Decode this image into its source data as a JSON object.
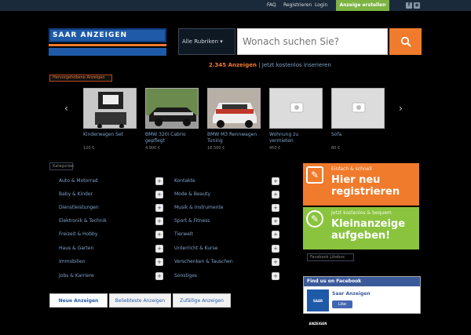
{
  "topbar": {
    "faq": "FAQ",
    "register": "Registrieren",
    "login": "Login",
    "create_ad": "Anzeige erstellen",
    "social_icons": [
      "facebook-icon",
      "rss-icon"
    ]
  },
  "logo": {
    "text": "SAAR ANZEIGEN"
  },
  "search": {
    "category": "Alle Rubriken",
    "placeholder": "Wonach suchen Sie?"
  },
  "subline": {
    "count": "2.345 Anzeigen",
    "rest": " | Jetzt kostenlos inserieren"
  },
  "featured": {
    "label": "Hervorgehobene Anzeigen",
    "items": [
      {
        "title": "Kinderwagen Set",
        "price": "120 €"
      },
      {
        "title": "BMW 320i Cabrio gepflegt",
        "price": "4.900 €"
      },
      {
        "title": "BMW M3 Rennwagen Tuning",
        "price": "18.500 €"
      },
      {
        "title": "Wohnung zu vermieten",
        "price": "450 €"
      },
      {
        "title": "Sofa",
        "price": "80 €"
      }
    ]
  },
  "categories": {
    "label": "Kategorien",
    "col1": [
      "Auto & Motorrad",
      "Baby & Kinder",
      "Dienstleistungen",
      "Elektronik & Technik",
      "Freizeit & Hobby",
      "Haus & Garten",
      "Immobilien",
      "Jobs & Karriere"
    ],
    "col2": [
      "Kontakte",
      "Mode & Beauty",
      "Musik & Instrumente",
      "Sport & Fitness",
      "Tierwelt",
      "Unterricht & Kurse",
      "Verschenken & Tauschen",
      "Sonstiges"
    ]
  },
  "tabs": [
    "Neue Anzeigen",
    "Beliebteste Anzeigen",
    "Zufällige Anzeigen"
  ],
  "promo1": {
    "small": "Einfach & schnell",
    "big": "Hier neu registrieren"
  },
  "promo2": {
    "small": "Jetzt kostenlos & bequem",
    "big": "Kleinanzeige aufgeben!"
  },
  "fb": {
    "label": "Facebook Likebox",
    "head": "Find us on Facebook",
    "page": "Saar Anzeigen",
    "like": "Like",
    "logo": "SAAR ANZEIGEN"
  },
  "colors": {
    "accent": "#f07b2c",
    "brand": "#1e5aa8",
    "green": "#7cb342"
  }
}
